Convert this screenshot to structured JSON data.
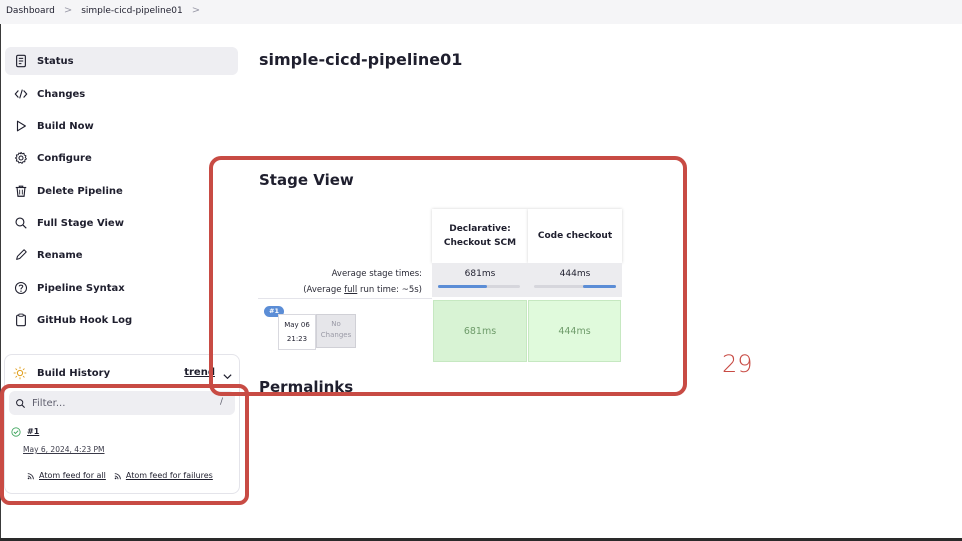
{
  "breadcrumb": {
    "items": [
      "Dashboard",
      "simple-cicd-pipeline01"
    ],
    "separator": ">"
  },
  "sidebar": {
    "items": [
      {
        "label": "Status",
        "icon": "document-icon",
        "active": true
      },
      {
        "label": "Changes",
        "icon": "code-icon"
      },
      {
        "label": "Build Now",
        "icon": "play-icon"
      },
      {
        "label": "Configure",
        "icon": "gear-icon"
      },
      {
        "label": "Delete Pipeline",
        "icon": "trash-icon"
      },
      {
        "label": "Full Stage View",
        "icon": "search-icon"
      },
      {
        "label": "Rename",
        "icon": "pencil-icon"
      },
      {
        "label": "Pipeline Syntax",
        "icon": "help-icon"
      },
      {
        "label": "GitHub Hook Log",
        "icon": "clipboard-icon"
      }
    ]
  },
  "build_history": {
    "title": "Build History",
    "trend_label": "trend",
    "filter_placeholder": "Filter...",
    "filter_shortcut": "/",
    "builds": [
      {
        "number": "#1",
        "date": "May 6, 2024, 4:23 PM",
        "status": "success"
      }
    ],
    "feed_all": "Atom feed for all",
    "feed_failures": "Atom feed for failures"
  },
  "main": {
    "title": "simple-cicd-pipeline01",
    "stage_view_title": "Stage View",
    "permalinks_title": "Permalinks"
  },
  "stage_view": {
    "stages": [
      {
        "name_line1": "Declarative:",
        "name_line2": "Checkout SCM",
        "avg": "681ms",
        "avg_fraction": 0.6,
        "run_time": "681ms"
      },
      {
        "name_line1": "Code checkout",
        "name_line2": "",
        "avg": "444ms",
        "avg_fraction": 0.4,
        "run_time": "444ms"
      }
    ],
    "avg_label_line1": "Average stage times:",
    "avg_label_line2_prefix": "(Average ",
    "avg_label_line2_link": "full",
    "avg_label_line2_suffix": " run time: ~5s)",
    "run": {
      "badge": "#1",
      "date": "May 06",
      "time": "21:23",
      "no_changes_line1": "No",
      "no_changes_line2": "Changes"
    }
  },
  "slide_number": "29",
  "colors": {
    "highlight": "#c84b44",
    "success_cell": "#d8f3d4",
    "accent_blue": "#5b8dd6"
  }
}
